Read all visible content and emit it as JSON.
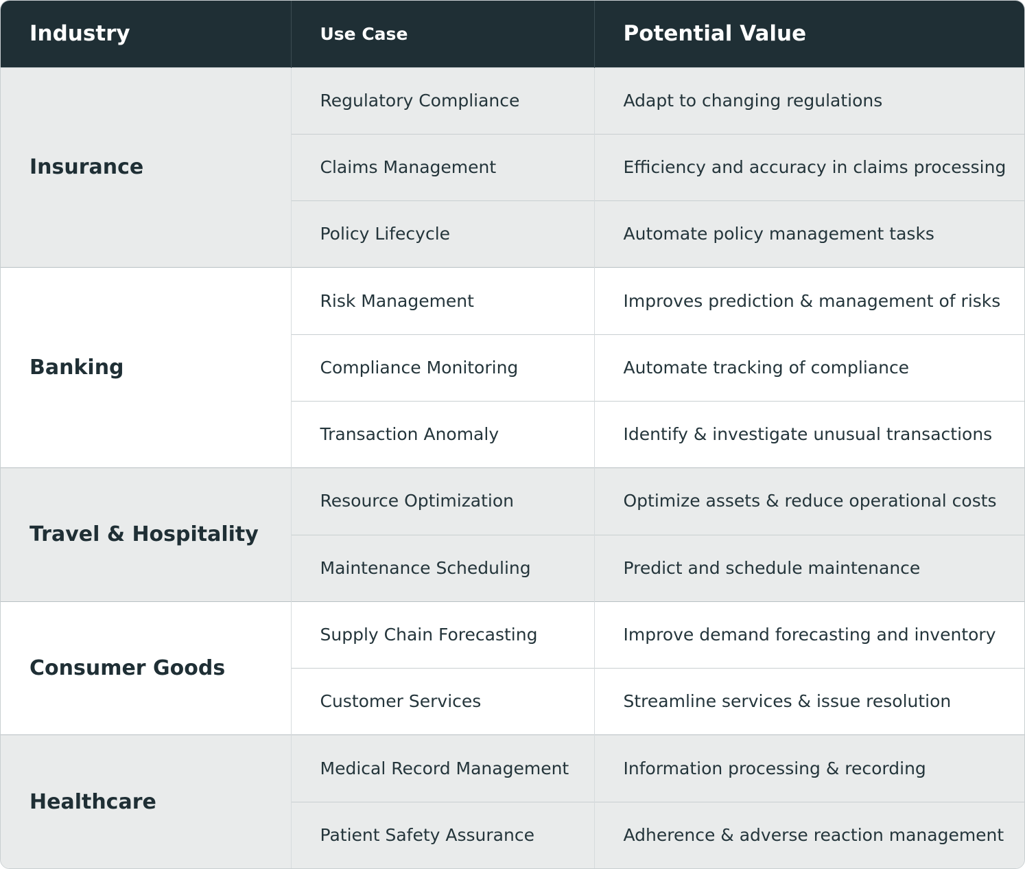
{
  "headers": {
    "industry": "Industry",
    "use_case": "Use Case",
    "potential_value": "Potential Value"
  },
  "colors": {
    "header_bg": "#1f2f35",
    "header_text": "#ffffff",
    "shaded_row_bg": "#e9ebeb",
    "plain_row_bg": "#ffffff",
    "text": "#1f2f35"
  },
  "groups": [
    {
      "industry": "Insurance",
      "shaded": true,
      "rows": [
        {
          "use_case": "Regulatory Compliance",
          "value": "Adapt to changing regulations"
        },
        {
          "use_case": "Claims Management",
          "value": "Efficiency and accuracy in claims processing"
        },
        {
          "use_case": "Policy Lifecycle",
          "value": "Automate policy management tasks"
        }
      ]
    },
    {
      "industry": "Banking",
      "shaded": false,
      "rows": [
        {
          "use_case": "Risk Management",
          "value": "Improves prediction & management of risks"
        },
        {
          "use_case": "Compliance Monitoring",
          "value": "Automate tracking of compliance"
        },
        {
          "use_case": "Transaction Anomaly",
          "value": "Identify & investigate unusual transactions"
        }
      ]
    },
    {
      "industry": "Travel & Hospitality",
      "shaded": true,
      "rows": [
        {
          "use_case": "Resource Optimization",
          "value": "Optimize assets & reduce operational costs"
        },
        {
          "use_case": "Maintenance Scheduling",
          "value": "Predict and schedule maintenance"
        }
      ]
    },
    {
      "industry": "Consumer Goods",
      "shaded": false,
      "rows": [
        {
          "use_case": "Supply Chain Forecasting",
          "value": "Improve demand forecasting and inventory"
        },
        {
          "use_case": "Customer Services",
          "value": "Streamline services & issue resolution"
        }
      ]
    },
    {
      "industry": "Healthcare",
      "shaded": true,
      "rows": [
        {
          "use_case": "Medical Record Management",
          "value": "Information processing & recording"
        },
        {
          "use_case": "Patient Safety Assurance",
          "value": "Adherence & adverse reaction management"
        }
      ]
    }
  ]
}
